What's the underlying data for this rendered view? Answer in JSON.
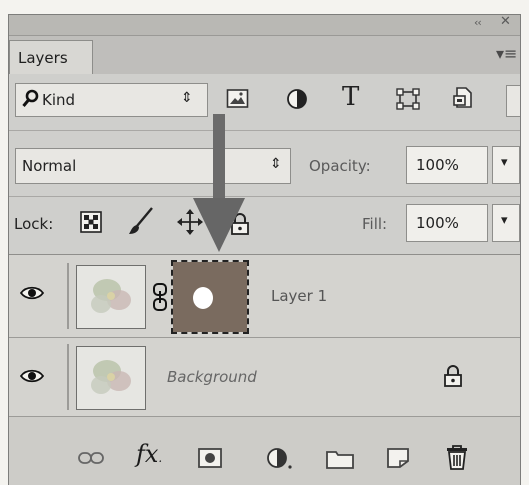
{
  "panel": {
    "tab_label": "Layers",
    "collapse_glyph": "‹‹",
    "close_glyph": "✕",
    "menu_glyph": "▾≡"
  },
  "filter": {
    "kind_icon": "search-icon",
    "kind_label": "Kind",
    "kind_arrows": "⇕",
    "icons": [
      "pixel-filter-icon",
      "adjustment-filter-icon",
      "type-filter-icon",
      "shape-filter-icon",
      "smart-object-filter-icon"
    ],
    "type_glyph": "T"
  },
  "blend": {
    "mode": "Normal",
    "arrows": "⇕",
    "opacity_label": "Opacity:",
    "opacity_value": "100%",
    "dropdown_glyph": "▾"
  },
  "lock": {
    "label": "Lock:",
    "icons": [
      "lock-transparent-pixels-icon",
      "lock-image-pixels-icon",
      "lock-position-icon",
      "lock-all-icon"
    ],
    "fill_label": "Fill:",
    "fill_value": "100%",
    "dropdown_glyph": "▾"
  },
  "layers": [
    {
      "name": "Layer 1",
      "visible": true,
      "has_mask": true,
      "linked": true
    },
    {
      "name": "Background",
      "visible": true,
      "locked": true
    }
  ],
  "footer": {
    "icons": [
      "link-layers-icon",
      "fx-icon",
      "add-mask-icon",
      "adjustment-layer-icon",
      "new-group-icon",
      "new-layer-icon",
      "delete-icon"
    ],
    "fx_label": "fx"
  },
  "annotation": {
    "arrow_color": "#6b6b6b"
  },
  "colors": {
    "panel_bg": "#cfcfcc",
    "field_bg": "#e8e7e3",
    "mask_bg": "#7a6b5f",
    "selected_row": "#d4d3cf"
  }
}
